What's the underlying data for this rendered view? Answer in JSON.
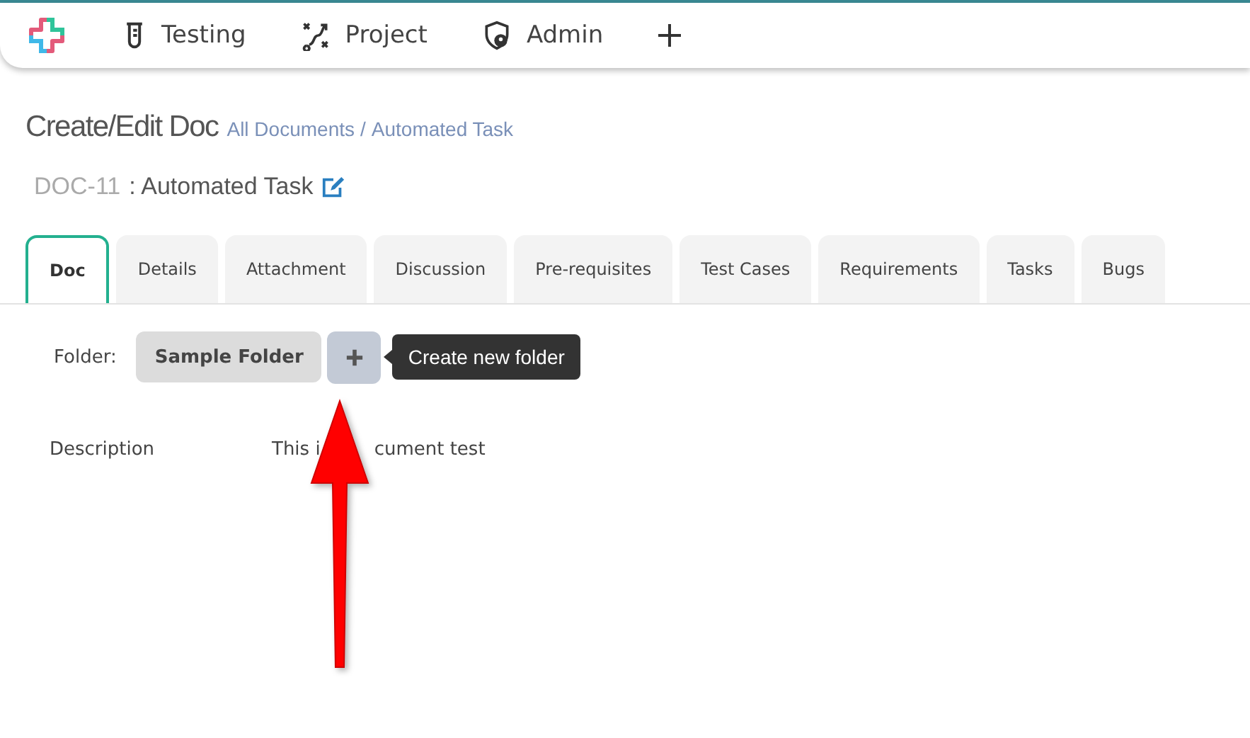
{
  "nav": {
    "items": [
      {
        "label": "Testing",
        "kind": "tube"
      },
      {
        "label": "Project",
        "kind": "route"
      },
      {
        "label": "Admin",
        "kind": "shield"
      }
    ]
  },
  "header": {
    "title": "Create/Edit Doc",
    "breadcrumb": [
      "All Documents",
      "Automated Task"
    ],
    "breadcrumb_separator": "/",
    "doc_id": "DOC-11",
    "doc_name": ": Automated Task"
  },
  "tabs": [
    {
      "label": "Doc",
      "selected": true
    },
    {
      "label": "Details",
      "selected": false
    },
    {
      "label": "Attachment",
      "selected": false
    },
    {
      "label": "Discussion",
      "selected": false
    },
    {
      "label": "Pre-requisites",
      "selected": false
    },
    {
      "label": "Test Cases",
      "selected": false
    },
    {
      "label": "Requirements",
      "selected": false
    },
    {
      "label": "Tasks",
      "selected": false
    },
    {
      "label": "Bugs",
      "selected": false
    }
  ],
  "folder": {
    "label": "Folder:",
    "value": "Sample Folder",
    "tooltip": "Create new folder"
  },
  "description": {
    "label": "Description",
    "value_parts": [
      "This i",
      "cument test"
    ]
  }
}
